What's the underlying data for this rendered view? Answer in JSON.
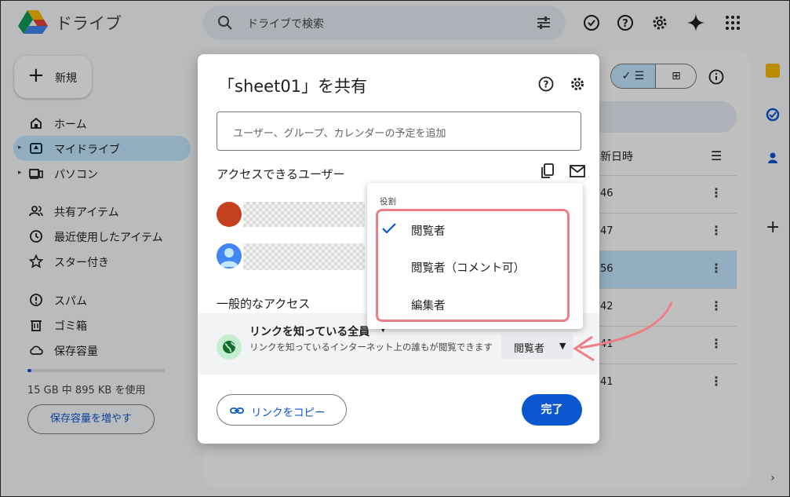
{
  "app": {
    "title": "ドライブ"
  },
  "search": {
    "placeholder": "ドライブで検索"
  },
  "sidebar": {
    "new_label": "新規",
    "items": [
      {
        "label": "ホーム",
        "icon": "home-icon"
      },
      {
        "label": "マイドライブ",
        "icon": "my-drive-icon",
        "active": true
      },
      {
        "label": "パソコン",
        "icon": "computer-icon"
      },
      {
        "label": "共有アイテム",
        "icon": "shared-icon"
      },
      {
        "label": "最近使用したアイテム",
        "icon": "clock-icon"
      },
      {
        "label": "スター付き",
        "icon": "star-icon"
      },
      {
        "label": "スパム",
        "icon": "spam-icon"
      },
      {
        "label": "ゴミ箱",
        "icon": "trash-icon"
      },
      {
        "label": "保存容量",
        "icon": "cloud-icon"
      }
    ],
    "storage_text": "15 GB 中 895 KB を使用",
    "storage_fraction": 6e-05,
    "more_storage_label": "保存容量を増やす"
  },
  "file_list": {
    "column_header": "新日時",
    "rows": [
      {
        "time": "46"
      },
      {
        "time": "47"
      },
      {
        "time": "56",
        "selected": true
      },
      {
        "time": "42"
      },
      {
        "time": "41"
      },
      {
        "time": "41"
      }
    ]
  },
  "dialog": {
    "title": "「sheet01」を共有",
    "add_placeholder": "ユーザー、グループ、カレンダーの予定を追加",
    "access_heading": "アクセスできるユーザー",
    "general_heading": "一般的なアクセス",
    "link_scope": "リンクを知っている全員",
    "link_description": "リンクを知っているインターネット上の誰もが閲覧できます",
    "current_role": "閲覧者",
    "copy_link_label": "リンクをコピー",
    "done_label": "完了"
  },
  "role_menu": {
    "header": "役割",
    "options": [
      {
        "label": "閲覧者",
        "checked": true
      },
      {
        "label": "閲覧者（コメント可）",
        "checked": false
      },
      {
        "label": "編集者",
        "checked": false
      }
    ]
  },
  "colors": {
    "accent": "#0b57d0",
    "active_nav": "#c2e7ff",
    "highlight_box": "#ee7e85",
    "annotation_arrow": "#ee7e85"
  }
}
